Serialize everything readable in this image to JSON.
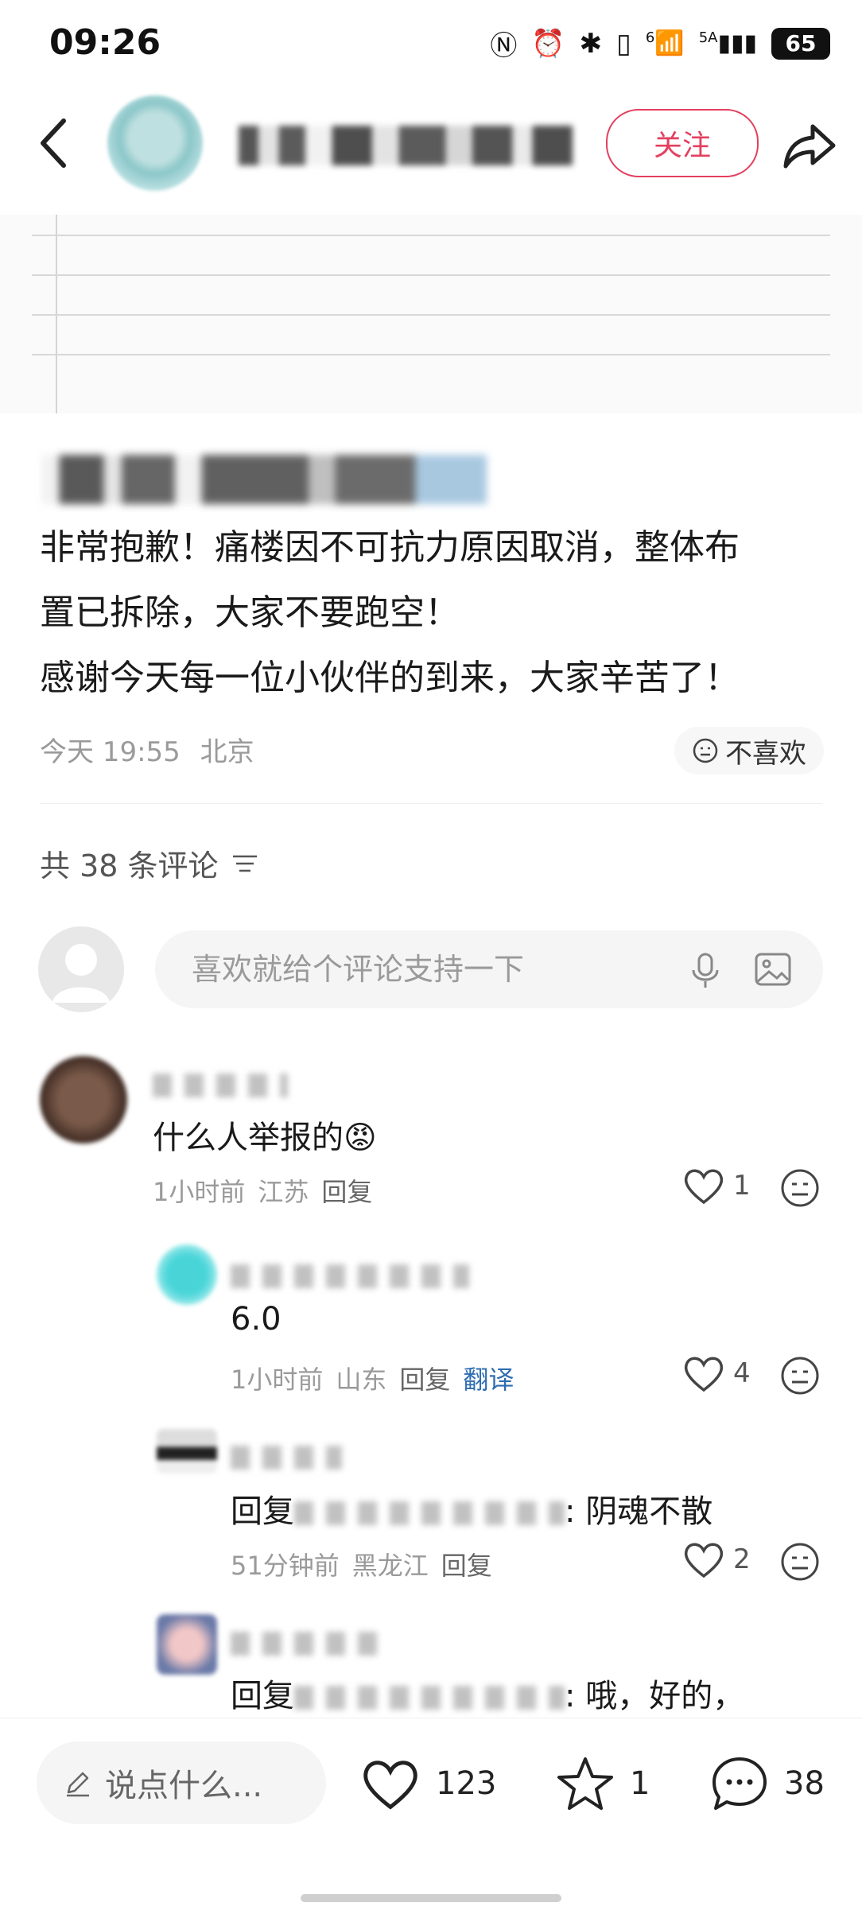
{
  "status": {
    "time": "09:26",
    "network": "5A",
    "signal_extra": "6",
    "battery": "65"
  },
  "header": {
    "follow_label": "关注"
  },
  "post": {
    "lines": [
      "非常抱歉！痛楼因不可抗力原因取消，整体布",
      "置已拆除，大家不要跑空！",
      "感谢今天每一位小伙伴的到来，大家辛苦了！"
    ],
    "time": "今天 19:55",
    "location": "北京",
    "dislike_label": "不喜欢"
  },
  "comments_header": {
    "count_text": "共 38 条评论"
  },
  "comment_input": {
    "placeholder": "喜欢就给个评论支持一下"
  },
  "comments": [
    {
      "text": "什么人举报的",
      "time": "1小时前",
      "location": "江苏",
      "reply": "回复",
      "likes": "1"
    },
    {
      "text": "6.0",
      "time": "1小时前",
      "location": "山东",
      "reply": "回复",
      "translate": "翻译",
      "likes": "4"
    },
    {
      "prefix": "回复",
      "text": ": 阴魂不散",
      "time": "51分钟前",
      "location": "黑龙江",
      "reply": "回复",
      "likes": "2"
    },
    {
      "prefix": "回复",
      "text": ": 哦，好的，"
    }
  ],
  "bottom_bar": {
    "say_placeholder": "说点什么...",
    "likes": "123",
    "stars": "1",
    "comments": "38"
  },
  "colors": {
    "accent": "#e3405f",
    "translate_link": "#2f6db0"
  }
}
